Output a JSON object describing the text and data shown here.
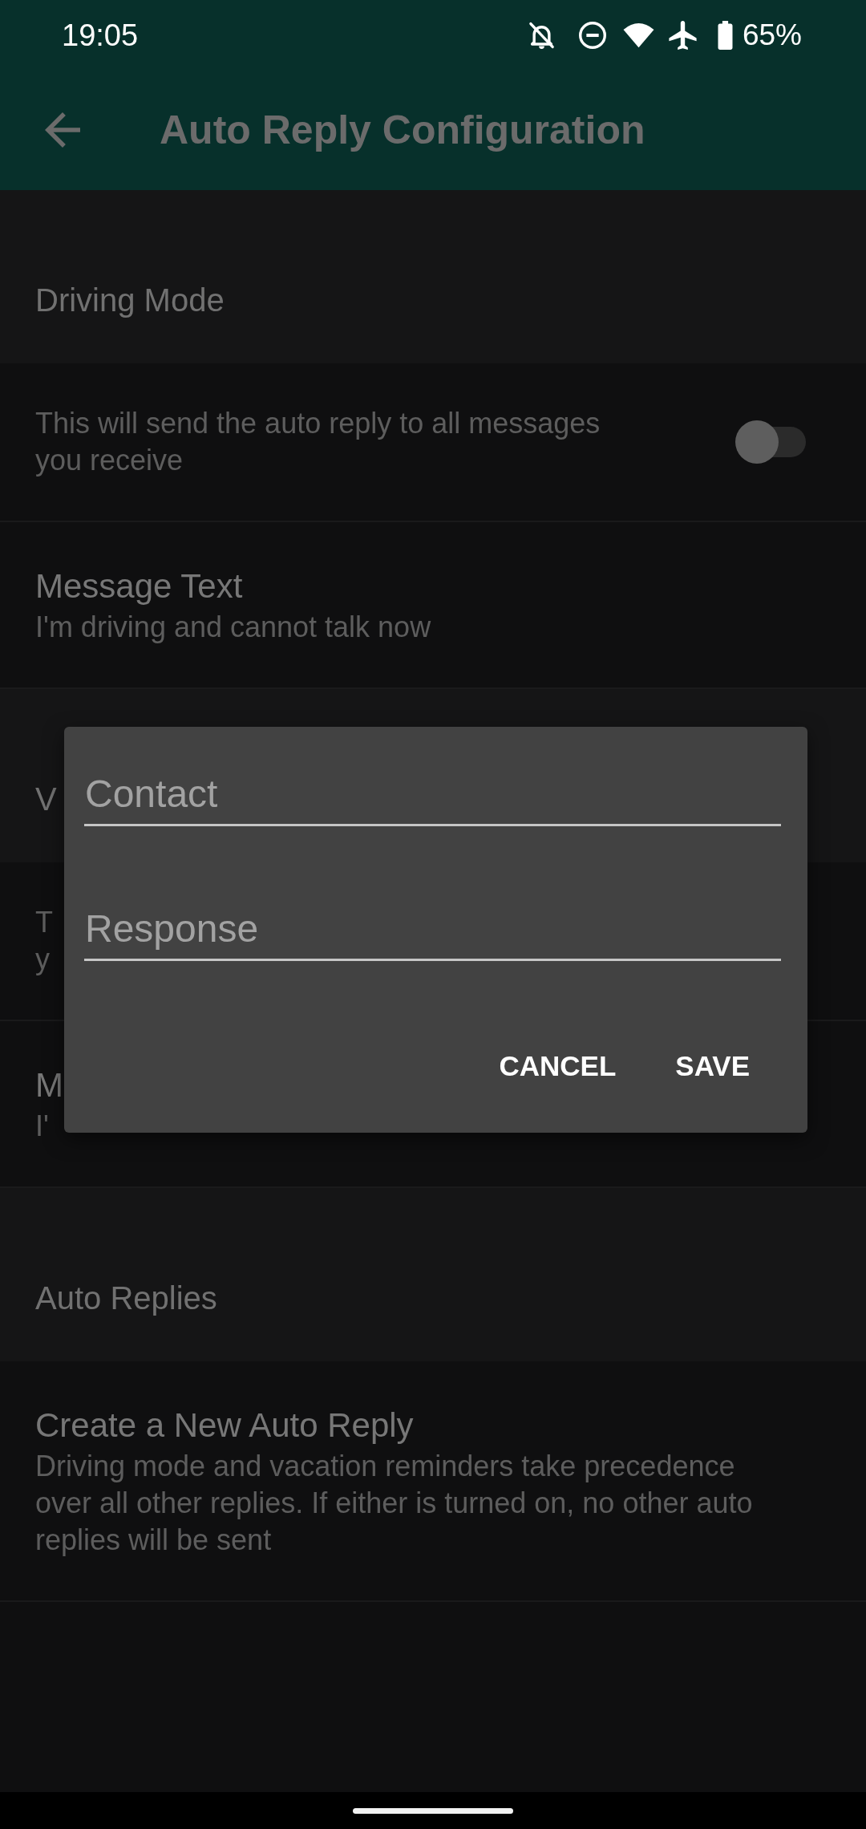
{
  "status_bar": {
    "time": "19:05",
    "battery": "65%"
  },
  "app_bar": {
    "title": "Auto Reply Configuration"
  },
  "preference_groups": [
    {
      "title": "Driving Mode",
      "items": [
        {
          "kind": "switch",
          "summary_lines": [
            "This will send the auto reply to all messages",
            "you receive"
          ],
          "on": false
        },
        {
          "kind": "text",
          "title": "Message Text",
          "summary_lines": [
            "I'm driving and cannot talk now"
          ]
        }
      ]
    },
    {
      "title": "V",
      "items": [
        {
          "kind": "text",
          "summary_lines": [
            "T",
            "y"
          ]
        },
        {
          "kind": "text",
          "title": "M",
          "summary_lines": [
            "I'"
          ]
        }
      ]
    },
    {
      "title": "Auto Replies",
      "items": [
        {
          "kind": "text",
          "title": "Create a New Auto Reply",
          "summary_lines": [
            "Driving mode and vacation reminders take precedence",
            "over all other replies. If either is turned on, no other auto",
            "replies will be sent"
          ]
        }
      ]
    }
  ],
  "dialog": {
    "fields": [
      {
        "placeholder": "Contact"
      },
      {
        "placeholder": "Response"
      }
    ],
    "buttons": [
      "CANCEL",
      "SAVE"
    ]
  }
}
